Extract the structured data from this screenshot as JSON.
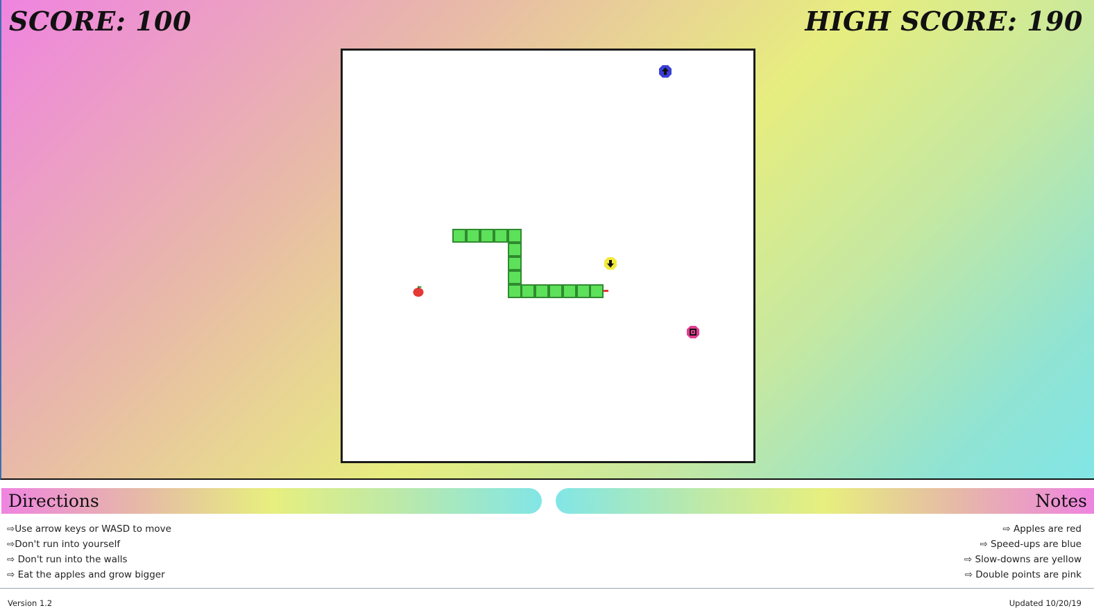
{
  "score": {
    "label": "SCORE: 100"
  },
  "high_score": {
    "label": "HIGH SCORE: 190"
  },
  "board": {
    "grid_cells": 30,
    "snake": {
      "color": "#5de05a",
      "segments": [
        [
          8,
          13
        ],
        [
          9,
          13
        ],
        [
          10,
          13
        ],
        [
          11,
          13
        ],
        [
          12,
          13
        ],
        [
          12,
          14
        ],
        [
          12,
          15
        ],
        [
          12,
          16
        ],
        [
          12,
          17
        ],
        [
          13,
          17
        ],
        [
          14,
          17
        ],
        [
          15,
          17
        ],
        [
          16,
          17
        ],
        [
          17,
          17
        ],
        [
          18,
          17
        ]
      ],
      "head": [
        18,
        17
      ],
      "direction": "right"
    },
    "items": [
      {
        "type": "apple",
        "name": "apple-icon",
        "color": "#e53935",
        "cell": [
          5,
          17
        ]
      },
      {
        "type": "speed-up",
        "name": "speed-up-icon",
        "color": "#3b3fd8",
        "cell": [
          23,
          1
        ]
      },
      {
        "type": "slow-down",
        "name": "slow-down-icon",
        "color": "#f2ea3b",
        "cell": [
          19,
          15
        ]
      },
      {
        "type": "double-points",
        "name": "double-points-icon",
        "color": "#e23d8f",
        "cell": [
          25,
          20
        ]
      }
    ]
  },
  "directions": {
    "title": "Directions",
    "items": [
      "⇨Use arrow keys or WASD to move",
      "⇨Don't run into yourself",
      "⇨ Don't run into the walls",
      "⇨ Eat the apples and grow bigger"
    ]
  },
  "notes": {
    "title": "Notes",
    "items": [
      "⇨ Apples are red",
      "⇨ Speed-ups are blue",
      "⇨ Slow-downs are yellow",
      "⇨ Double points are pink"
    ]
  },
  "footer": {
    "version": "Version 1.2",
    "updated": "Updated 10/20/19"
  }
}
